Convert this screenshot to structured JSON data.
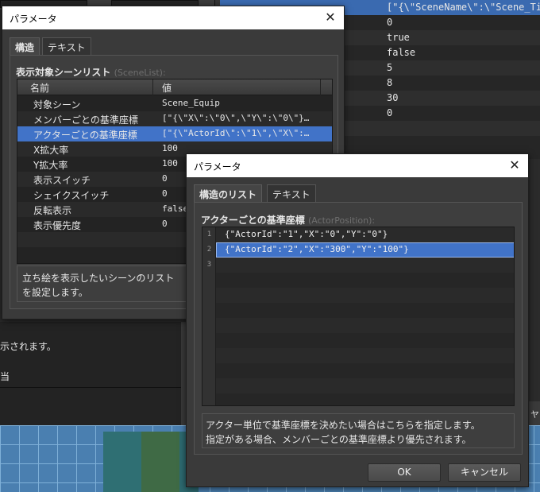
{
  "background": {
    "right_table_rows": [
      {
        "value": "[\"{\\\"SceneName\\\":\\\"Scene_Title",
        "selected": true
      },
      {
        "value": "0"
      },
      {
        "value": "true"
      },
      {
        "value": "false"
      },
      {
        "value": "5"
      },
      {
        "value": "8"
      },
      {
        "value": "30"
      },
      {
        "value": "0"
      }
    ],
    "left_fragment_1": "示されます。",
    "left_fragment_2": "当",
    "right_edge_glyph": "ヤ"
  },
  "dialog1": {
    "title": "パラメータ",
    "close_glyph": "✕",
    "tabs": [
      "構造",
      "テキスト"
    ],
    "active_tab": 0,
    "caption": "表示対象シーンリスト",
    "caption_hint": "(SceneList):",
    "columns": [
      "名前",
      "値"
    ],
    "rows": [
      {
        "name": "対象シーン",
        "value": "Scene_Equip"
      },
      {
        "name": "メンバーごとの基準座標",
        "value": "[\"{\\\"X\\\":\\\"0\\\",\\\"Y\\\":\\\"0\\\"}…"
      },
      {
        "name": "アクターごとの基準座標",
        "value": "[\"{\\\"ActorId\\\":\\\"1\\\",\\\"X\\\":…",
        "selected": true
      },
      {
        "name": "X拡大率",
        "value": "100"
      },
      {
        "name": "Y拡大率",
        "value": "100"
      },
      {
        "name": "表示スイッチ",
        "value": "0"
      },
      {
        "name": "シェイクスイッチ",
        "value": "0"
      },
      {
        "name": "反転表示",
        "value": "false"
      },
      {
        "name": "表示優先度",
        "value": "0"
      }
    ],
    "description_lines": [
      "立ち絵を表示したいシーンのリスト",
      "を設定します。"
    ]
  },
  "dialog2": {
    "title": "パラメータ",
    "close_glyph": "✕",
    "tabs": [
      "構造のリスト",
      "テキスト"
    ],
    "active_tab": 0,
    "caption": "アクターごとの基準座標",
    "caption_hint": "(ActorPosition):",
    "list_items": [
      {
        "num": "1",
        "text": "{\"ActorId\":\"1\",\"X\":\"0\",\"Y\":\"0\"}"
      },
      {
        "num": "2",
        "text": "{\"ActorId\":\"2\",\"X\":\"300\",\"Y\":\"100\"}",
        "selected": true
      },
      {
        "num": "3",
        "text": ""
      }
    ],
    "description_lines": [
      "アクター単位で基準座標を決めたい場合はこちらを指定します。",
      "指定がある場合、メンバーごとの基準座標より優先されます。"
    ],
    "ok_label": "OK",
    "cancel_label": "キャンセル"
  },
  "colors": {
    "selection": "#4173c8",
    "dialog_bg": "#3a3a3a",
    "titlebar": "#ffffff"
  }
}
